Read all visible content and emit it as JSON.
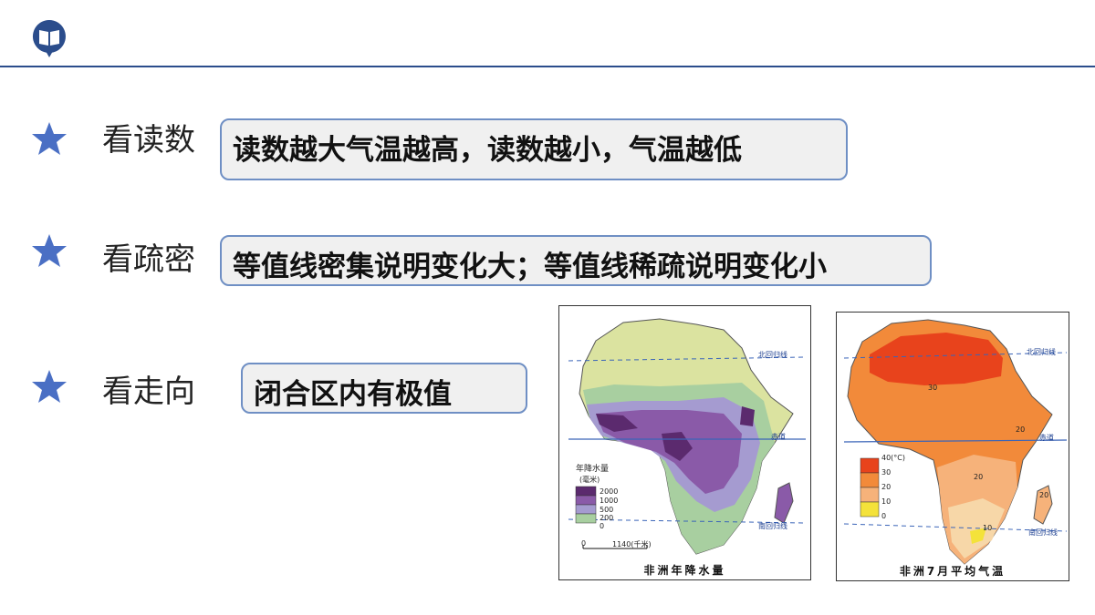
{
  "header": {
    "logo_icon": "open-book-icon",
    "line_color": "#2b4d8c"
  },
  "rows": [
    {
      "icon": "star-icon",
      "label": "看读数",
      "answer": "读数越大气温越高，读数越小，气温越低"
    },
    {
      "icon": "star-icon",
      "label": "看疏密",
      "answer": "等值线密集说明变化大；等值线稀疏说明变化小"
    },
    {
      "icon": "star-icon",
      "label": "看走向",
      "answer": "闭合区内有极值"
    }
  ],
  "colors": {
    "star": "#4a6fc4",
    "box_border": "#6f8fc4",
    "box_fill": "#f0f0f0"
  },
  "precip_map": {
    "caption": "非洲年降水量",
    "legend_title": "年降水量",
    "legend_unit": "(毫米)",
    "legend_values": [
      "2000",
      "1000",
      "500",
      "200",
      "0"
    ],
    "legend_colors": [
      "#5b2a6e",
      "#8a5aa8",
      "#a59bd0",
      "#a8cfa0",
      "#dbe3a0"
    ],
    "scale_start": "0",
    "scale_end": "1140(千米)",
    "labels": {
      "tropic_north": "北回归线",
      "equator": "赤道",
      "tropic_south": "南回归线"
    }
  },
  "temp_map": {
    "caption": "非洲7月平均气温",
    "legend_values": [
      "40(°C)",
      "30",
      "20",
      "10",
      "0"
    ],
    "legend_colors": [
      "#e8431c",
      "#f28a3a",
      "#f6b27a",
      "#f7d7a8",
      "#f4e23a"
    ],
    "isotherm_labels": [
      "30",
      "20",
      "20",
      "10",
      "20"
    ],
    "labels": {
      "tropic_north": "北回归线",
      "equator": "赤道",
      "tropic_south": "南回归线"
    }
  }
}
